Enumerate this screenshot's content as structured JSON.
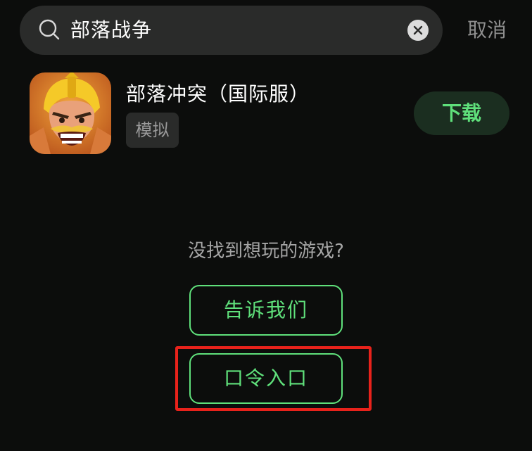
{
  "search": {
    "query": "部落战争",
    "cancel_label": "取消"
  },
  "result": {
    "app_name": "部落冲突（国际服）",
    "tag": "模拟",
    "download_label": "下载"
  },
  "empty_prompt": {
    "text": "没找到想玩的游戏?",
    "tell_us_label": "告诉我们",
    "code_entry_label": "口令入口"
  },
  "colors": {
    "background": "#0c0d0c",
    "accent_green": "#5fe07b",
    "highlight_red": "#e8221b"
  }
}
